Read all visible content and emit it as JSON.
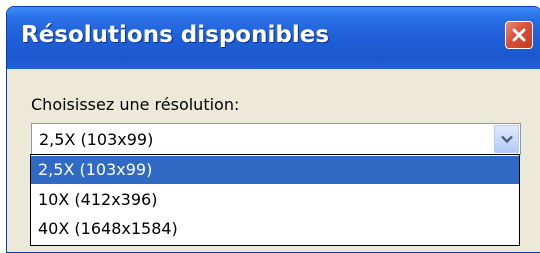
{
  "dialog": {
    "title": "Résolutions disponibles",
    "label": "Choisissez une résolution:",
    "selected_value": "2,5X (103x99)",
    "options": [
      "2,5X (103x99)",
      "10X (412x396)",
      "40X (1648x1584)"
    ],
    "selected_index": 0
  },
  "colors": {
    "titlebar": "#1f5fd9",
    "selection": "#316ac5",
    "close_button": "#d8503a",
    "dialog_background": "#ece9d8"
  },
  "icons": {
    "close": "close-icon",
    "dropdown": "chevron-down-icon"
  }
}
